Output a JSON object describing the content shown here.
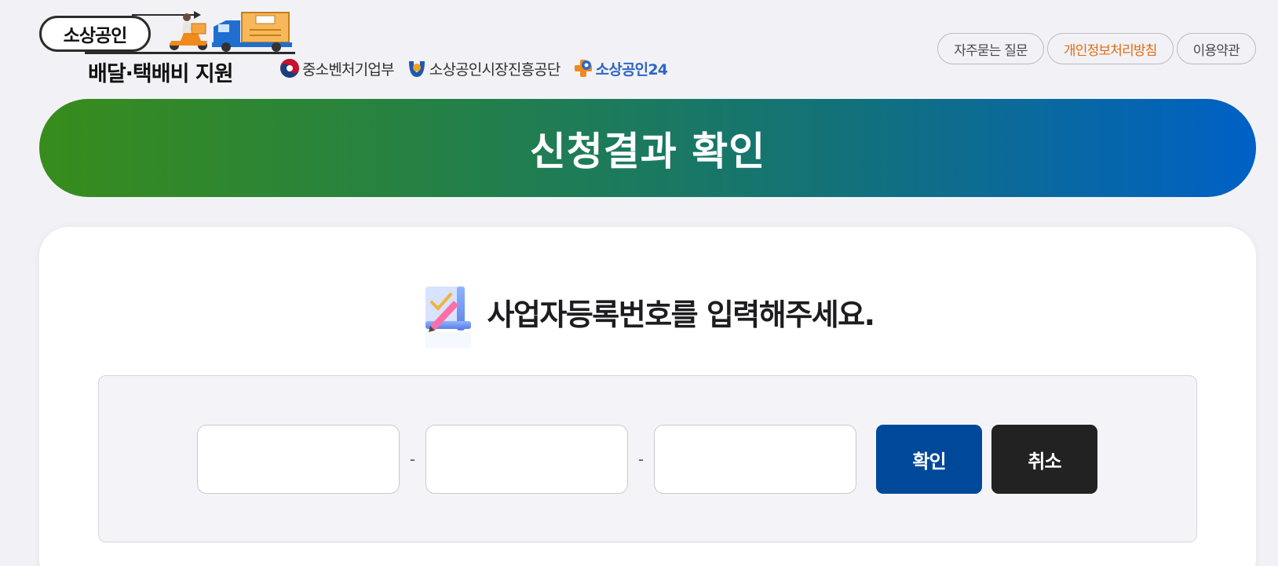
{
  "header": {
    "logo_main": "소상공인",
    "logo_sub": "배달·택배비 지원",
    "partners": [
      {
        "label": "중소벤처기업부"
      },
      {
        "label": "소상공인시장진흥공단"
      },
      {
        "label": "소상공인",
        "suffix": "24"
      }
    ],
    "links": [
      {
        "label": "자주묻는 질문"
      },
      {
        "label": "개인정보처리방침"
      },
      {
        "label": "이용약관"
      }
    ]
  },
  "banner": {
    "title": "신청결과 확인"
  },
  "main": {
    "prompt": "사업자등록번호를 입력해주세요.",
    "fields": [
      {
        "value": "",
        "placeholder": ""
      },
      {
        "value": "",
        "placeholder": ""
      },
      {
        "value": "",
        "placeholder": ""
      }
    ],
    "separator": "-",
    "confirm_label": "확인",
    "cancel_label": "취소"
  },
  "colors": {
    "banner_start": "#388c1c",
    "banner_end": "#0060c6",
    "confirm_button": "#00499a",
    "cancel_button": "#222222",
    "accent_link": "#e36b12"
  },
  "icons": {
    "scooter": "delivery-scooter-icon",
    "truck": "delivery-truck-icon",
    "ministry": "taegeuk-emblem-icon",
    "semas": "semas-emblem-icon",
    "sbiz24": "sbiz24-emblem-icon",
    "prompt": "form-pencil-icon"
  }
}
